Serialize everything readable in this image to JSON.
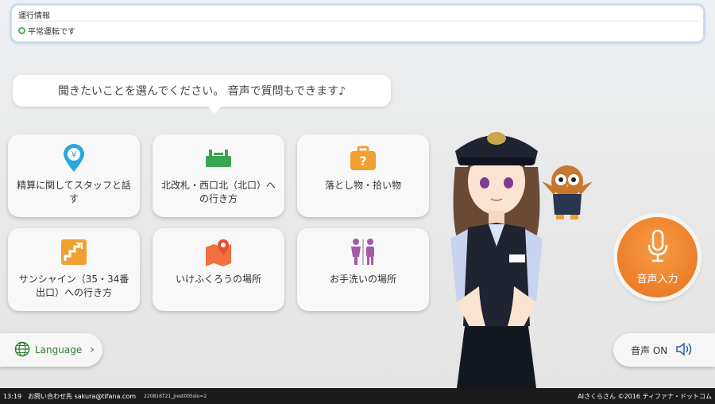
{
  "status": {
    "title": "運行情報",
    "message": "平常運転です"
  },
  "prompt": "聞きたいことを選んでください。 音声で質問もできます♪",
  "cards": [
    {
      "label": "精算に関してスタッフと話す",
      "icon": "yen-pin-icon"
    },
    {
      "label": "北改札・西口北（北口）への行き方",
      "icon": "ticket-gate-icon"
    },
    {
      "label": "落とし物・拾い物",
      "icon": "lost-item-bag-icon"
    },
    {
      "label": "サンシャイン（35・34番出口）への行き方",
      "icon": "stairs-icon"
    },
    {
      "label": "いけふくろうの場所",
      "icon": "map-pin-icon"
    },
    {
      "label": "お手洗いの場所",
      "icon": "restroom-icon"
    }
  ],
  "language_button": "Language",
  "voice_input_label": "音声入力",
  "sound_label": "音声 ON",
  "footer": {
    "time": "13:19",
    "contact": "お問い合わせ先 sakura@tifana.com",
    "version": "220816T21_jrest005slo=2",
    "credit": "AIさくらさん ©2016 ティファナ・ドットコム"
  },
  "colors": {
    "accent_orange": "#f0802a",
    "icon_blue": "#29a8d8",
    "icon_green": "#3aa655",
    "icon_purple": "#a45aa7",
    "status_ok": "#4caf50"
  }
}
